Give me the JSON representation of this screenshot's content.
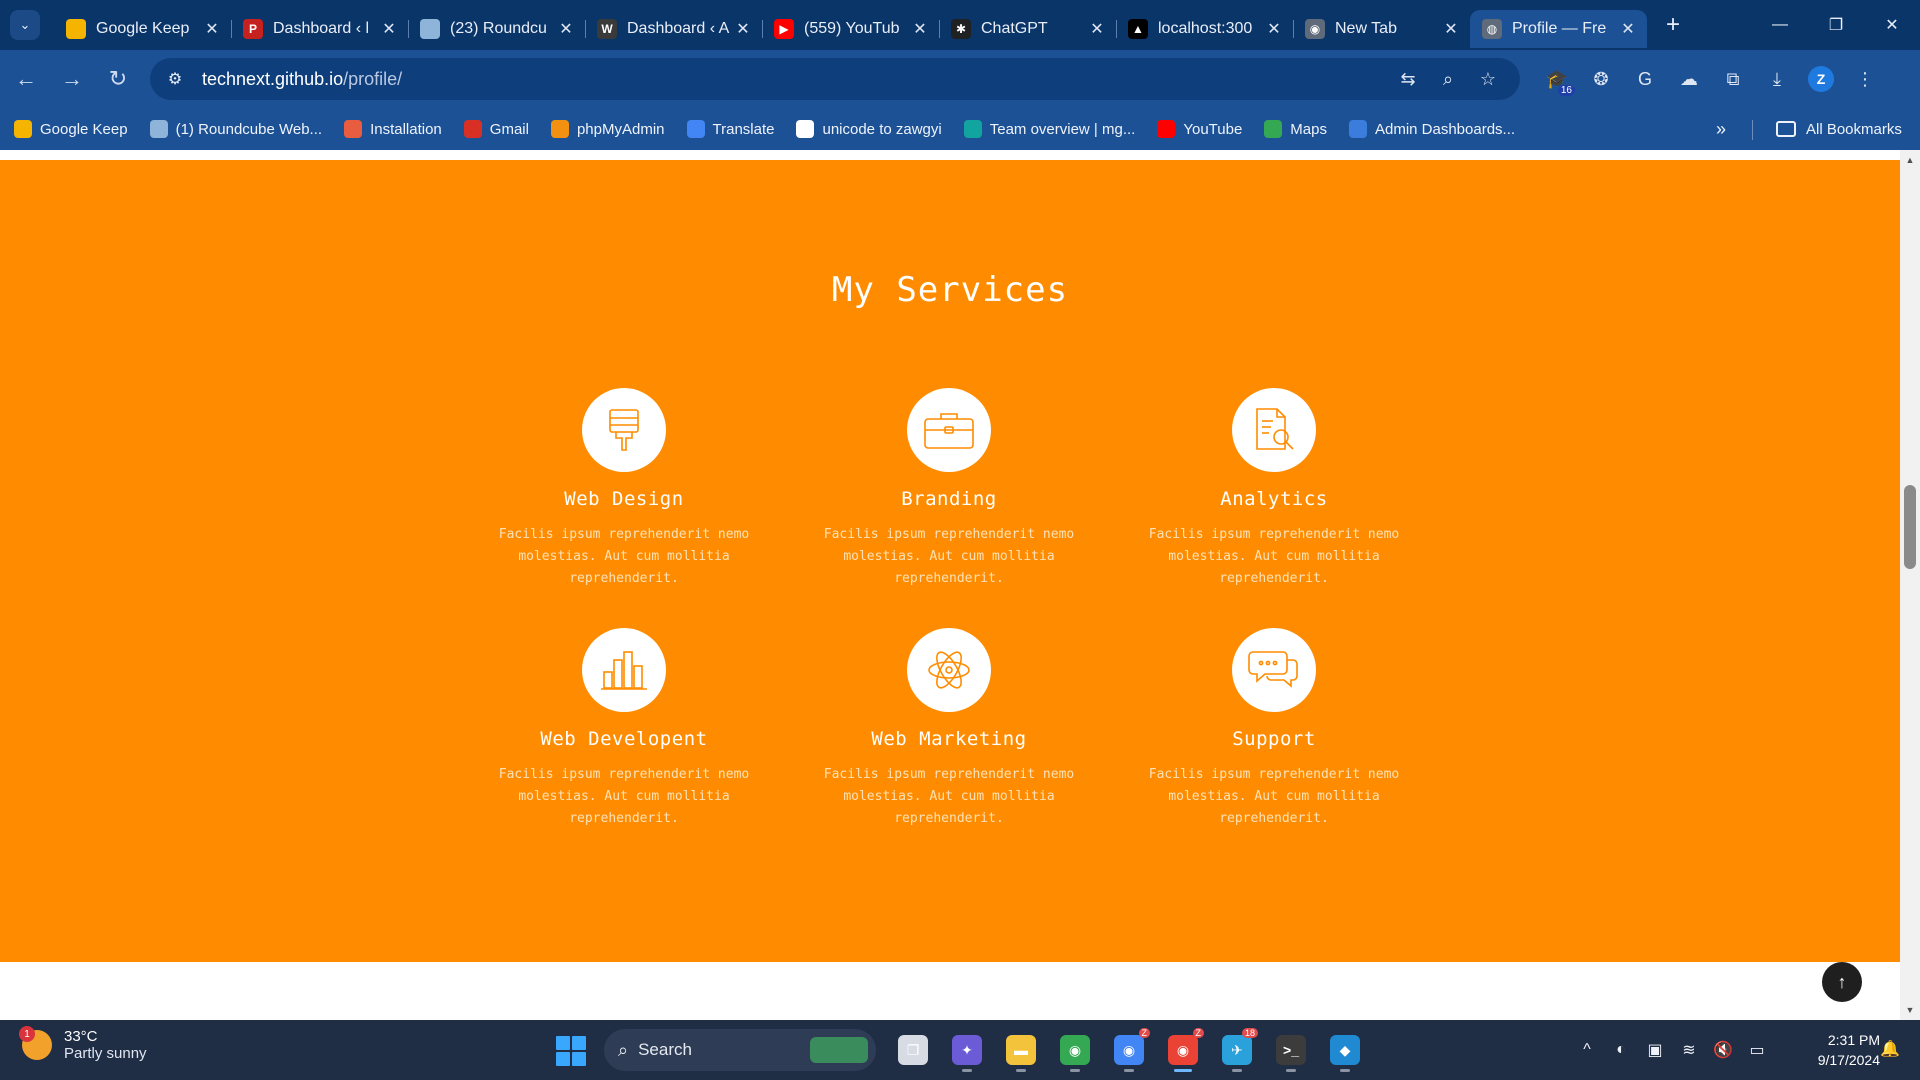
{
  "browser": {
    "tabs": [
      {
        "title": "Google Keep",
        "favicon": "keep-icon",
        "color": "#f4b400",
        "glyph": ""
      },
      {
        "title": "Dashboard ‹ l",
        "favicon": "p-logo-icon",
        "color": "#c5221f",
        "glyph": "P"
      },
      {
        "title": "(23) Roundcu",
        "favicon": "roundcube-icon",
        "color": "#8fb4d9",
        "glyph": ""
      },
      {
        "title": "Dashboard ‹ A",
        "favicon": "wordpress-icon",
        "color": "#3a3a3a",
        "glyph": "W"
      },
      {
        "title": "(559) YouTub",
        "favicon": "youtube-icon",
        "color": "#ff0000",
        "glyph": "▶"
      },
      {
        "title": "ChatGPT",
        "favicon": "chatgpt-icon",
        "color": "#202123",
        "glyph": "✱"
      },
      {
        "title": "localhost:300",
        "favicon": "triangle-icon",
        "color": "#000000",
        "glyph": "▲"
      },
      {
        "title": "New Tab",
        "favicon": "chrome-icon",
        "color": "#5f6b7a",
        "glyph": "◉"
      },
      {
        "title": "Profile — Fre",
        "favicon": "globe-icon",
        "color": "#5f6b7a",
        "glyph": "◍",
        "active": true
      }
    ],
    "url_host": "technext.github.io",
    "url_path": "/profile/",
    "extension_badge": "16",
    "profile_initial": "Z",
    "bookmarks": [
      {
        "label": "Google Keep",
        "icon": "keep-icon",
        "color": "#f4b400"
      },
      {
        "label": "(1) Roundcube Web...",
        "icon": "roundcube-icon",
        "color": "#8fb4d9"
      },
      {
        "label": "Installation",
        "icon": "installation-icon",
        "color": "#e85d3f"
      },
      {
        "label": "Gmail",
        "icon": "gmail-icon",
        "color": "#d93025"
      },
      {
        "label": "phpMyAdmin",
        "icon": "phpmyadmin-icon",
        "color": "#f29111"
      },
      {
        "label": "Translate",
        "icon": "translate-icon",
        "color": "#4285f4"
      },
      {
        "label": "unicode to zawgyi",
        "icon": "globe-icon",
        "color": "#ffffff"
      },
      {
        "label": "Team overview | mg...",
        "icon": "diamond-icon",
        "color": "#12a5a0"
      },
      {
        "label": "YouTube",
        "icon": "youtube-icon",
        "color": "#ff0000"
      },
      {
        "label": "Maps",
        "icon": "maps-icon",
        "color": "#34a853"
      },
      {
        "label": "Admin Dashboards...",
        "icon": "admin-icon",
        "color": "#3b7ddd"
      }
    ],
    "all_bookmarks_label": "All Bookmarks"
  },
  "page": {
    "section_title": "My Services",
    "services": [
      {
        "name": "Web Design",
        "icon": "paint-brush-icon",
        "desc": [
          "Facilis ipsum reprehenderit nemo",
          "molestias. Aut cum mollitia",
          "reprehenderit."
        ]
      },
      {
        "name": "Branding",
        "icon": "briefcase-icon",
        "desc": [
          "Facilis ipsum reprehenderit nemo",
          "molestias. Aut cum mollitia",
          "reprehenderit."
        ]
      },
      {
        "name": "Analytics",
        "icon": "document-search-icon",
        "desc": [
          "Facilis ipsum reprehenderit nemo",
          "molestias. Aut cum mollitia",
          "reprehenderit."
        ]
      },
      {
        "name": "Web Developent",
        "icon": "bar-chart-icon",
        "desc": [
          "Facilis ipsum reprehenderit nemo",
          "molestias. Aut cum mollitia",
          "reprehenderit."
        ]
      },
      {
        "name": "Web Marketing",
        "icon": "atom-icon",
        "desc": [
          "Facilis ipsum reprehenderit nemo",
          "molestias. Aut cum mollitia",
          "reprehenderit."
        ]
      },
      {
        "name": "Support",
        "icon": "chat-bubbles-icon",
        "desc": [
          "Facilis ipsum reprehenderit nemo",
          "molestias. Aut cum mollitia",
          "reprehenderit."
        ]
      }
    ],
    "accent_color": "#ff8c00"
  },
  "taskbar": {
    "weather_temp": "33°C",
    "weather_desc": "Partly sunny",
    "weather_badge": "1",
    "search_label": "Search",
    "apps": [
      {
        "name": "task-view-icon",
        "color": "#d7dce4",
        "glyph": "❐"
      },
      {
        "name": "copilot-icon",
        "color": "#6b5bd6",
        "glyph": "✦"
      },
      {
        "name": "file-explorer-icon",
        "color": "#f3c33c",
        "glyph": "▬"
      },
      {
        "name": "chrome-icon",
        "color": "#34a853",
        "glyph": "◉"
      },
      {
        "name": "chrome-profile-icon",
        "color": "#4285f4",
        "glyph": "◉",
        "badge": "Z"
      },
      {
        "name": "chrome-profile-active-icon",
        "color": "#ea4335",
        "glyph": "◉",
        "badge": "Z",
        "active": true
      },
      {
        "name": "telegram-icon",
        "color": "#2aa1da",
        "glyph": "✈",
        "badge": "18"
      },
      {
        "name": "terminal-icon",
        "color": "#3c3c3c",
        "glyph": ">_"
      },
      {
        "name": "vscode-icon",
        "color": "#1f8ad2",
        "glyph": "◆"
      }
    ],
    "time": "2:31 PM",
    "date": "9/17/2024"
  }
}
